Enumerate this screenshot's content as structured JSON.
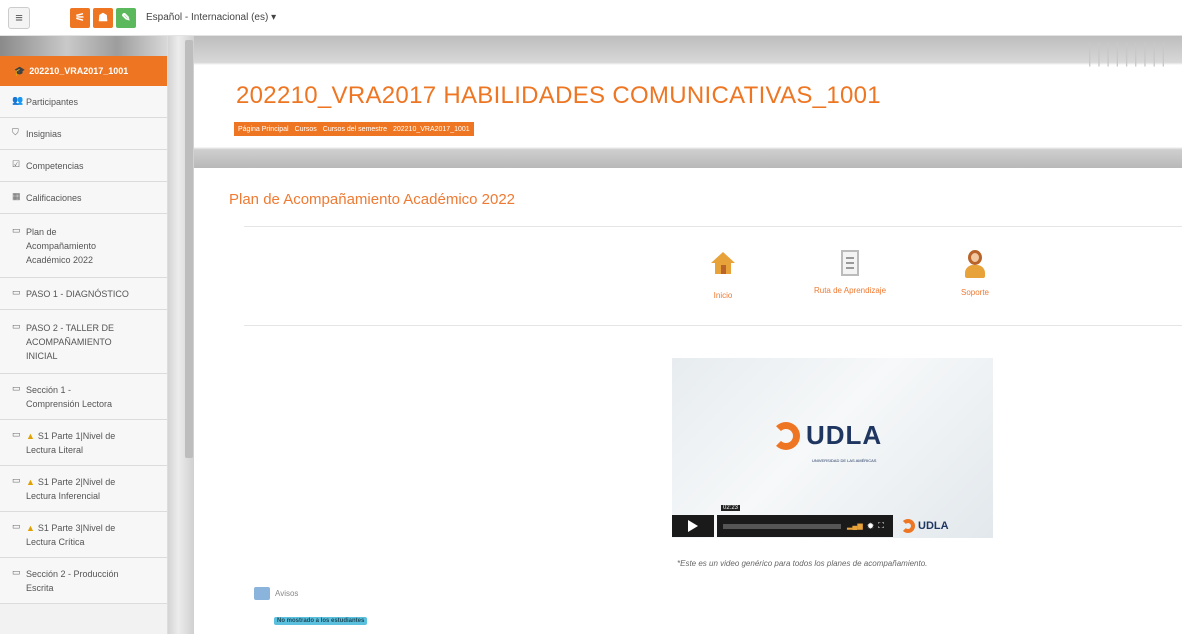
{
  "topbar": {
    "language": "Español - Internacional (es) ▾",
    "buttons": [
      {
        "icon": "share-icon",
        "color": "#ee7623",
        "glyph": "⚟"
      },
      {
        "icon": "users-icon",
        "color": "#ee7623",
        "glyph": "☗"
      },
      {
        "icon": "edit-icon",
        "color": "#5cb85c",
        "glyph": "✎"
      }
    ]
  },
  "sidebar": {
    "course": "202210_VRA2017_1001",
    "items": [
      {
        "icon": "users-icon",
        "glyph": "👥",
        "label": "Participantes"
      },
      {
        "icon": "shield-icon",
        "glyph": "⛉",
        "label": "Insignias"
      },
      {
        "icon": "check-icon",
        "glyph": "☑",
        "label": "Competencias"
      },
      {
        "icon": "table-icon",
        "glyph": "▦",
        "label": "Calificaciones"
      },
      {
        "icon": "folder-icon",
        "glyph": "▭",
        "label": "Plan de\nAcompañamiento\nAcadémico 2022"
      },
      {
        "icon": "folder-icon",
        "glyph": "▭",
        "label": "PASO 1 - DIAGNÓSTICO"
      },
      {
        "icon": "folder-icon",
        "glyph": "▭",
        "label": "PASO 2 - TALLER DE\nACOMPAÑAMIENTO\nINICIAL"
      },
      {
        "icon": "folder-icon",
        "glyph": "▭",
        "label": "Sección 1 -\nComprensión Lectora"
      },
      {
        "icon": "folder-icon",
        "glyph": "▭",
        "warn": true,
        "label": "S1 Parte 1|Nivel de\nLectura Literal"
      },
      {
        "icon": "folder-icon",
        "glyph": "▭",
        "warn": true,
        "label": "S1 Parte 2|Nivel de\nLectura Inferencial"
      },
      {
        "icon": "folder-icon",
        "glyph": "▭",
        "warn": true,
        "label": "S1 Parte 3|Nivel de\nLectura Crítica"
      },
      {
        "icon": "folder-icon",
        "glyph": "▭",
        "label": "Sección 2 - Producción\nEscrita"
      }
    ]
  },
  "header": {
    "course_title": "202210_VRA2017 HABILIDADES COMUNICATIVAS_1001",
    "breadcrumb": [
      "Página Principal",
      "Cursos",
      "Cursos del semestre",
      "202210_VRA2017_1001"
    ]
  },
  "main": {
    "section_title": "Plan de Acompañamiento Académico 2022",
    "nav": [
      {
        "icon": "house-icon",
        "label": "Inicio"
      },
      {
        "icon": "document-icon",
        "label": "Ruta de Aprendizaje"
      },
      {
        "icon": "support-person-icon",
        "label": "Soporte"
      }
    ],
    "video": {
      "brand": "UDLA",
      "brand_sub": "UNIVERSIDAD DE LAS AMÉRICAS",
      "time": "02:23",
      "bar_brand": "UDLA"
    },
    "caption": "*Este es un video genérico para todos los planes de acompañamiento.",
    "avisos": "Avisos",
    "hidden_badge": "No mostrado a los estudiantes"
  },
  "colors": {
    "accent": "#ee7623",
    "navy": "#1f3660"
  }
}
